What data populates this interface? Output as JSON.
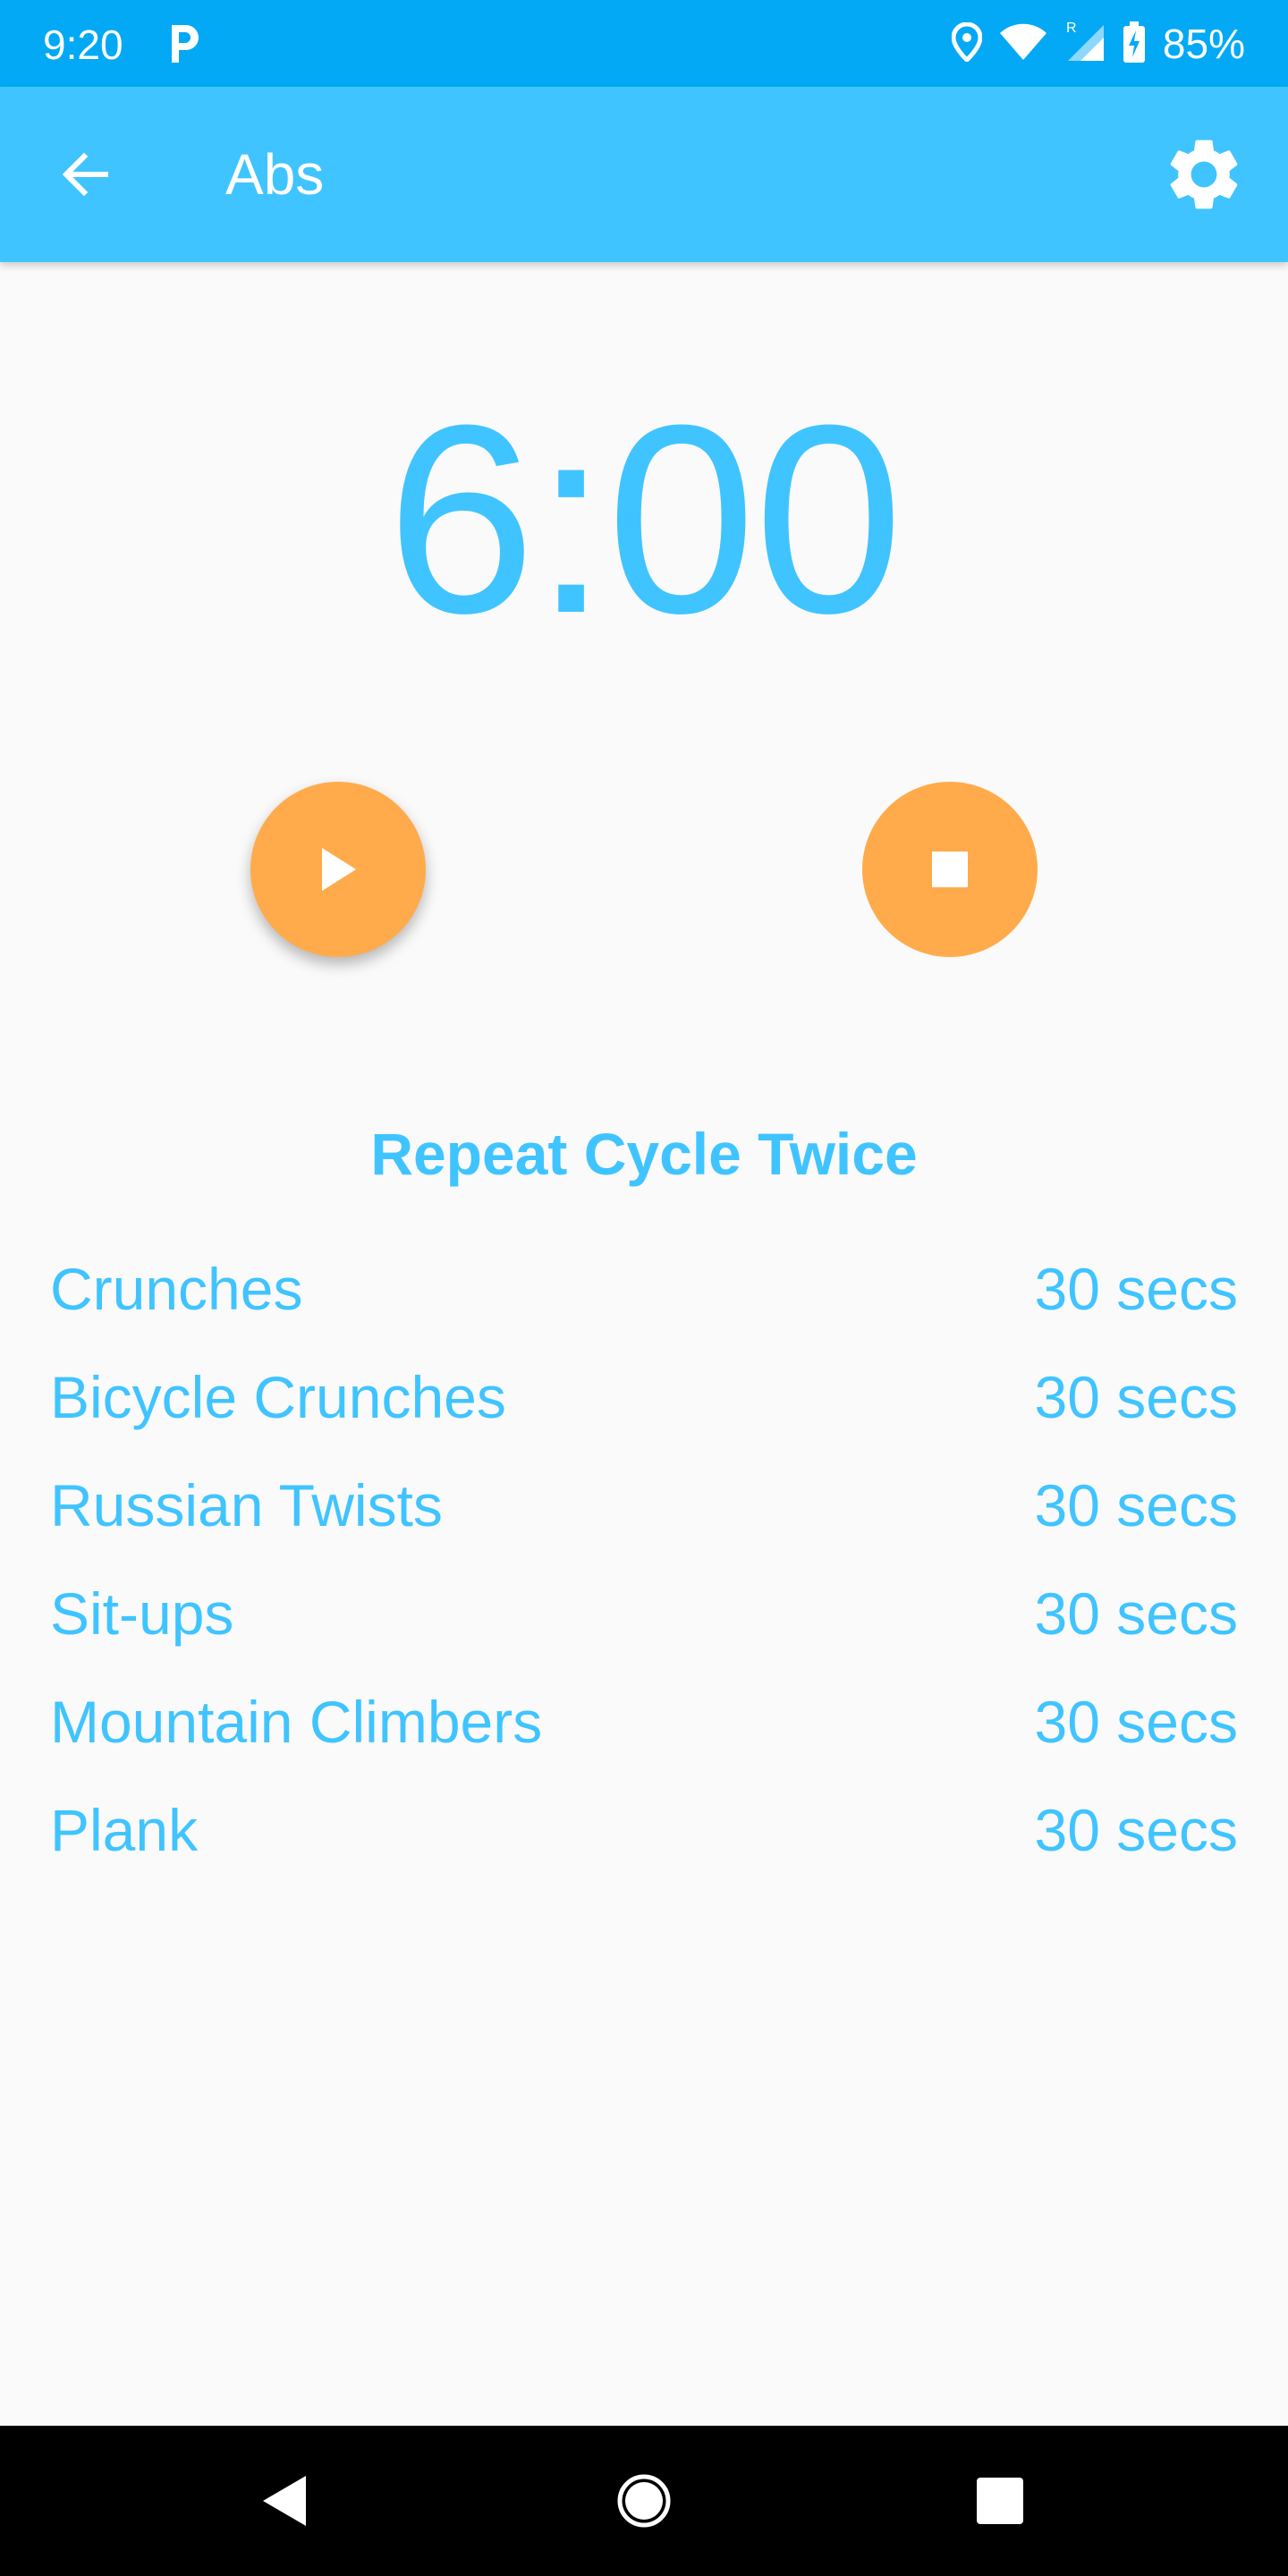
{
  "status_bar": {
    "time": "9:20",
    "battery": "85%",
    "background": "#03a9f4"
  },
  "app_bar": {
    "title": "Abs",
    "background": "#40c4ff",
    "back_icon": "arrow-back-icon",
    "settings_icon": "gear-icon"
  },
  "timer": {
    "display": "6:00",
    "color": "#40c4ff"
  },
  "controls": {
    "play_icon": "play-icon",
    "stop_icon": "stop-icon",
    "color": "#ffab4c"
  },
  "workout": {
    "title": "Repeat Cycle Twice",
    "exercises": [
      {
        "name": "Crunches",
        "duration": "30 secs"
      },
      {
        "name": "Bicycle Crunches",
        "duration": "30 secs"
      },
      {
        "name": "Russian Twists",
        "duration": "30 secs"
      },
      {
        "name": "Sit-ups",
        "duration": "30 secs"
      },
      {
        "name": "Mountain Climbers",
        "duration": "30 secs"
      },
      {
        "name": "Plank",
        "duration": "30 secs"
      }
    ]
  },
  "nav_bar": {
    "back_icon": "nav-back-icon",
    "home_icon": "nav-home-icon",
    "recents_icon": "nav-recents-icon"
  }
}
